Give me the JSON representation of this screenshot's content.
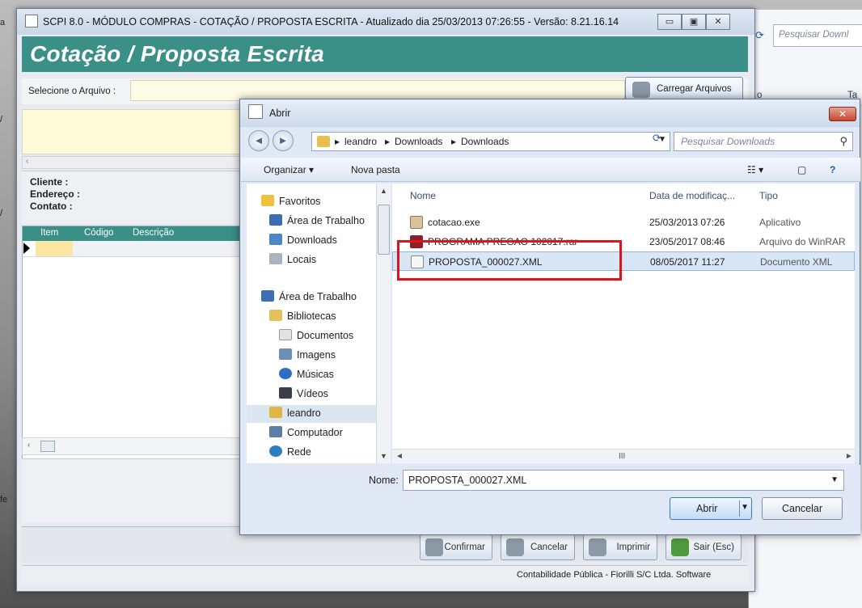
{
  "background_window": {
    "search_placeholder": "Pesquisar Downl",
    "col_partial_1": "o",
    "col_partial_2": "Ta"
  },
  "left_edge": {
    "glyph_1": "a",
    "glyph_2": "/",
    "glyph_3": "/",
    "glyph_4": "fe"
  },
  "main_window": {
    "title": "SCPI 8.0 - MÓDULO COMPRAS - COTAÇÃO / PROPOSTA ESCRITA - Atualizado dia 25/03/2013 07:26:55 - Versão: 8.21.16.14",
    "window_buttons": {
      "minimize": "▭",
      "maximize": "▣",
      "close": "✕"
    },
    "header_title": "Cotação / Proposta Escrita",
    "select_file_label": "Selecione o Arquivo :",
    "select_file_value": "",
    "load_button": "Carregar Arquivos",
    "scroll_left_arrow": "‹",
    "info": {
      "cliente": "Cliente :",
      "endereco": "Endereço :",
      "contato": "Contato :"
    },
    "grid_columns": [
      "Item",
      "Código",
      "Descrição"
    ],
    "buttons": {
      "confirmar": "Confirmar",
      "cancelar": "Cancelar",
      "imprimir": "Imprimir",
      "sair": "Sair (Esc)"
    },
    "status": "Contabilidade Pública - Fiorilli S/C Ltda. Software"
  },
  "dialog": {
    "title": "Abrir",
    "close": "✕",
    "breadcrumb": [
      "leandro",
      "Downloads",
      "Downloads"
    ],
    "search_placeholder": "Pesquisar Downloads",
    "toolbar": {
      "organize": "Organizar ▾",
      "new_folder": "Nova pasta"
    },
    "nav": {
      "favorites": "Favoritos",
      "desktop": "Área de Trabalho",
      "downloads": "Downloads",
      "places": "Locais",
      "desktop2": "Área de Trabalho",
      "libraries": "Bibliotecas",
      "documents": "Documentos",
      "images": "Imagens",
      "music": "Músicas",
      "videos": "Vídeos",
      "user": "leandro",
      "computer": "Computador",
      "network": "Rede"
    },
    "columns": {
      "name": "Nome",
      "date": "Data de modificaç...",
      "type": "Tipo"
    },
    "files": [
      {
        "name": "cotacao.exe",
        "date": "25/03/2013 07:26",
        "type": "Aplicativo"
      },
      {
        "name": "PROGRAMA PREGAO 102017.rar",
        "date": "23/05/2017 08:46",
        "type": "Arquivo do WinRAR"
      },
      {
        "name": "PROPOSTA_000027.XML",
        "date": "08/05/2017 11:27",
        "type": "Documento XML"
      }
    ],
    "filename_label": "Nome:",
    "filename_value": "PROPOSTA_000027.XML",
    "open_button": "Abrir",
    "cancel_button": "Cancelar",
    "scroll_mid": "III"
  },
  "colors": {
    "accent": "#3a8f87",
    "highlight_box": "#e0131d",
    "field_yellow": "#fffce6"
  }
}
